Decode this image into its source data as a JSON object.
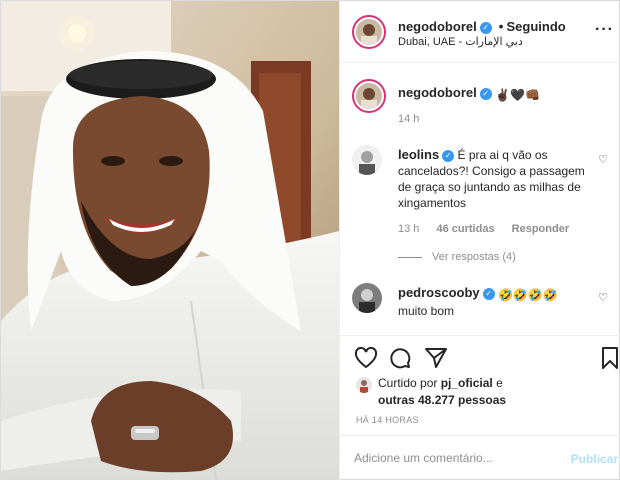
{
  "post": {
    "username": "negodoborel",
    "follow_separator": "•",
    "follow_status": "Seguindo",
    "location": "Dubai, UAE - دبي الإمارات",
    "more_icon": "ellipsis-icon"
  },
  "caption": {
    "username": "negodoborel",
    "emojis": "✌🏿🖤👊🏾",
    "time": "14 h"
  },
  "comments": [
    {
      "username": "leolins",
      "text": "É pra ai q vão os cancelados?! Consigo a passagem de graça so juntando as milhas de xingamentos",
      "time": "13 h",
      "likes": "46 curtidas",
      "reply": "Responder",
      "view_replies": "Ver respostas (4)"
    },
    {
      "username": "pedroscooby",
      "emojis": "🤣🤣🤣🤣",
      "text": "muito bom"
    }
  ],
  "actions": {
    "like_icon": "heart-icon",
    "comment_icon": "comment-icon",
    "share_icon": "paper-plane-icon",
    "save_icon": "bookmark-icon"
  },
  "likes": {
    "prefix": "Curtido por",
    "user": "pj_oficial",
    "suffix": "e",
    "others": "outras 48.277 pessoas"
  },
  "timestamp": "HÁ 14 HORAS",
  "add_comment": {
    "placeholder": "Adicione um comentário...",
    "publish": "Publicar"
  },
  "colors": {
    "verified": "#3897f0",
    "ring": "#d93175",
    "publish_disabled": "#b2dffc",
    "meta": "#8e8e8e"
  }
}
